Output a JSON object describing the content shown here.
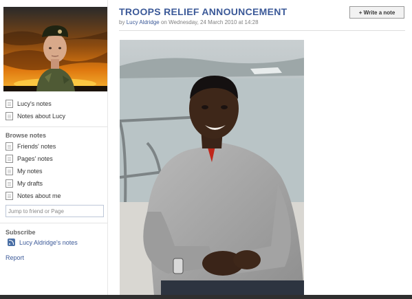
{
  "sidebar": {
    "profile_items": [
      {
        "label": "Lucy's notes"
      },
      {
        "label": "Notes about Lucy"
      }
    ],
    "browse_heading": "Browse notes",
    "browse_items": [
      {
        "label": "Friends' notes"
      },
      {
        "label": "Pages' notes"
      },
      {
        "label": "My notes"
      },
      {
        "label": "My drafts"
      },
      {
        "label": "Notes about me"
      }
    ],
    "jump_placeholder": "Jump to friend or Page",
    "subscribe_heading": "Subscribe",
    "subscribe_link": "Lucy Aldridge's notes",
    "report_link": "Report"
  },
  "note": {
    "title": "TROOPS RELIEF ANNOUNCEMENT",
    "byline_prefix": "by",
    "author": "Lucy Aldridge",
    "date_text": "on Wednesday, 24 March 2010 at 14:28"
  },
  "toolbar": {
    "write_note_label": "+ Write a note"
  },
  "icons": {
    "note_item": "note-icon",
    "subscribe": "rss-icon"
  },
  "colors": {
    "link": "#3b5998",
    "muted": "#808080",
    "heading": "#666666"
  }
}
